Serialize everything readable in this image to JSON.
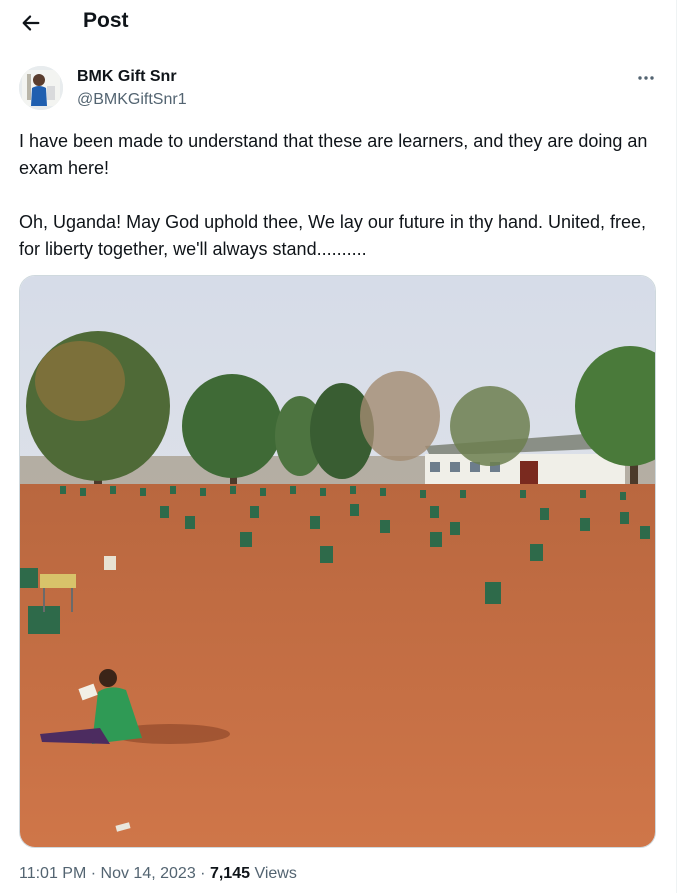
{
  "header": {
    "title": "Post"
  },
  "author": {
    "display_name": "BMK Gift Snr",
    "handle": "@BMKGiftSnr1"
  },
  "post": {
    "text_paragraph_1": "I have been made to understand that these are learners, and they are doing an exam here!",
    "text_paragraph_2": "Oh, Uganda! May God uphold thee, We lay our future in thy hand. United, free, for liberty together, we'll always stand.........."
  },
  "meta": {
    "time": "11:01 PM",
    "separator": "·",
    "date": "Nov 14, 2023",
    "views_count": "7,145",
    "views_label": "Views"
  },
  "icons": {
    "back": "arrow-left-icon",
    "more": "more-horizontal-icon"
  },
  "colors": {
    "text_primary": "#0f1419",
    "text_secondary": "#536471",
    "border": "#cfd9de",
    "sky": "#dfe4ec",
    "ground": "#c46a3f"
  }
}
